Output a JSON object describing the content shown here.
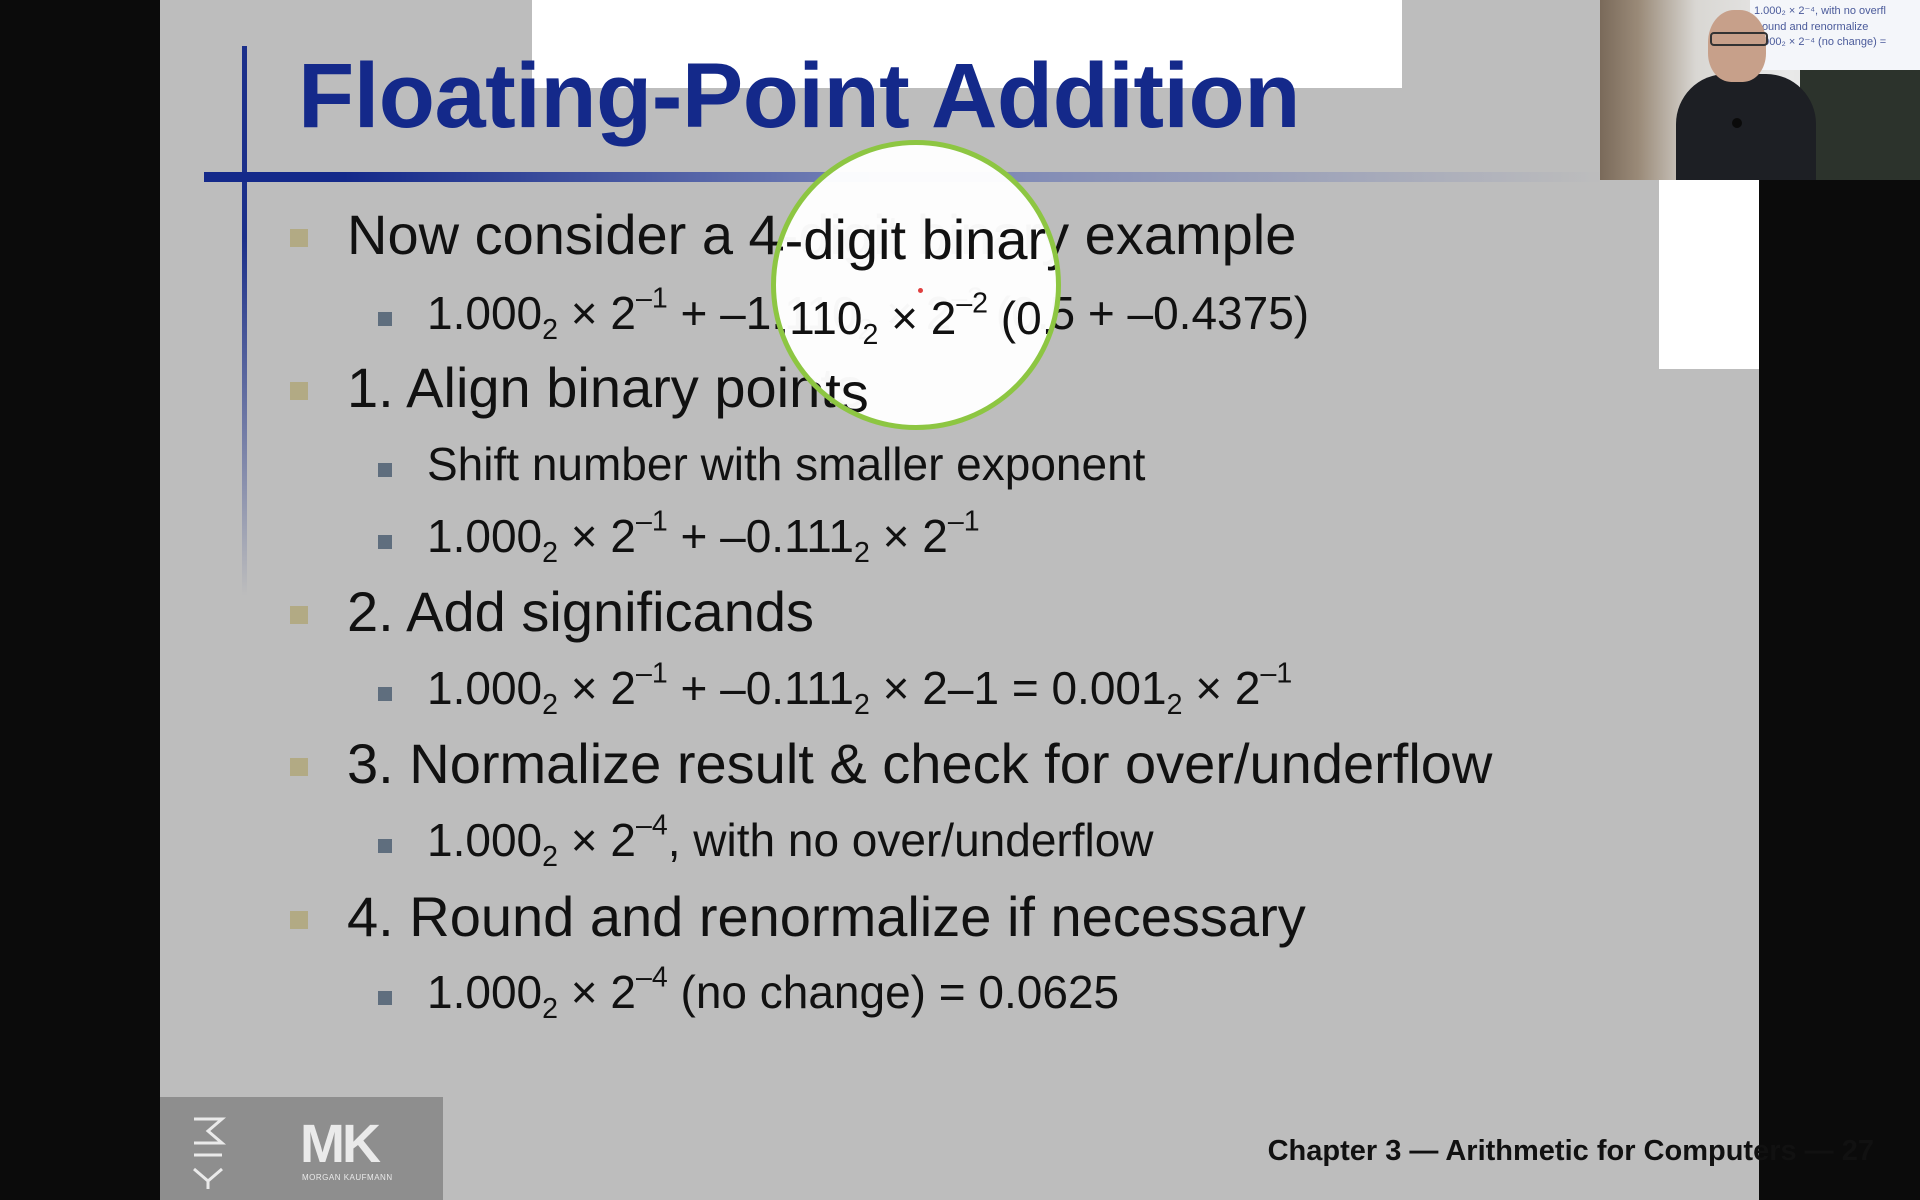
{
  "slide": {
    "title": "Floating-Point Addition",
    "footer": "Chapter 3 — Arithmetic for Computers — 27",
    "logo": {
      "side_text": "MK",
      "main_text": "MK",
      "sub_text": "MORGAN KAUFMANN"
    },
    "bullets": {
      "b0": "Now consider a 4-digit binary example",
      "b0s0": {
        "p1": "1.000",
        "p2": "2",
        "p3": " × 2",
        "p4": "–1",
        "p5": " + –1.110",
        "p6": "2",
        "p7": " × 2",
        "p8": "–2",
        "p9": " (0.5 + –0.4375)"
      },
      "b1": "1. Align binary points",
      "b1s0": "Shift number with smaller exponent",
      "b1s1": {
        "p1": "1.000",
        "p2": "2",
        "p3": " × 2",
        "p4": "–1",
        "p5": " + –0.111",
        "p6": "2",
        "p7": " × 2",
        "p8": "–1"
      },
      "b2": "2. Add significands",
      "b2s0": {
        "p1": "1.000",
        "p2": "2",
        "p3": " × 2",
        "p4": "–1",
        "p5": " + –0.111",
        "p6": "2",
        "p7": " × 2–1 = 0.001",
        "p8": "2",
        "p9": " × 2",
        "p10": "–1"
      },
      "b3": "3. Normalize result & check for over/underflow",
      "b3s0": {
        "p1": "1.000",
        "p2": "2",
        "p3": " × 2",
        "p4": "–4",
        "p5": ", with no over/underflow"
      },
      "b4": "4. Round and renormalize if necessary",
      "b4s0": {
        "p1": "1.000",
        "p2": "2",
        "p3": " × 2",
        "p4": "–4",
        "p5": " (no change)  = 0.0625"
      }
    }
  },
  "webcam": {
    "screen_lines": [
      "1.000₂ × 2⁻⁴, with no overfl",
      "Round and renormalize",
      "1.000₂ × 2⁻⁴ (no change) ="
    ]
  },
  "colors": {
    "title": "#14298a",
    "slide_bg": "#bdbdbd",
    "magnifier_ring": "#8dc642",
    "level1_marker": "#b2aa84",
    "level2_marker": "#5f6e7e"
  }
}
